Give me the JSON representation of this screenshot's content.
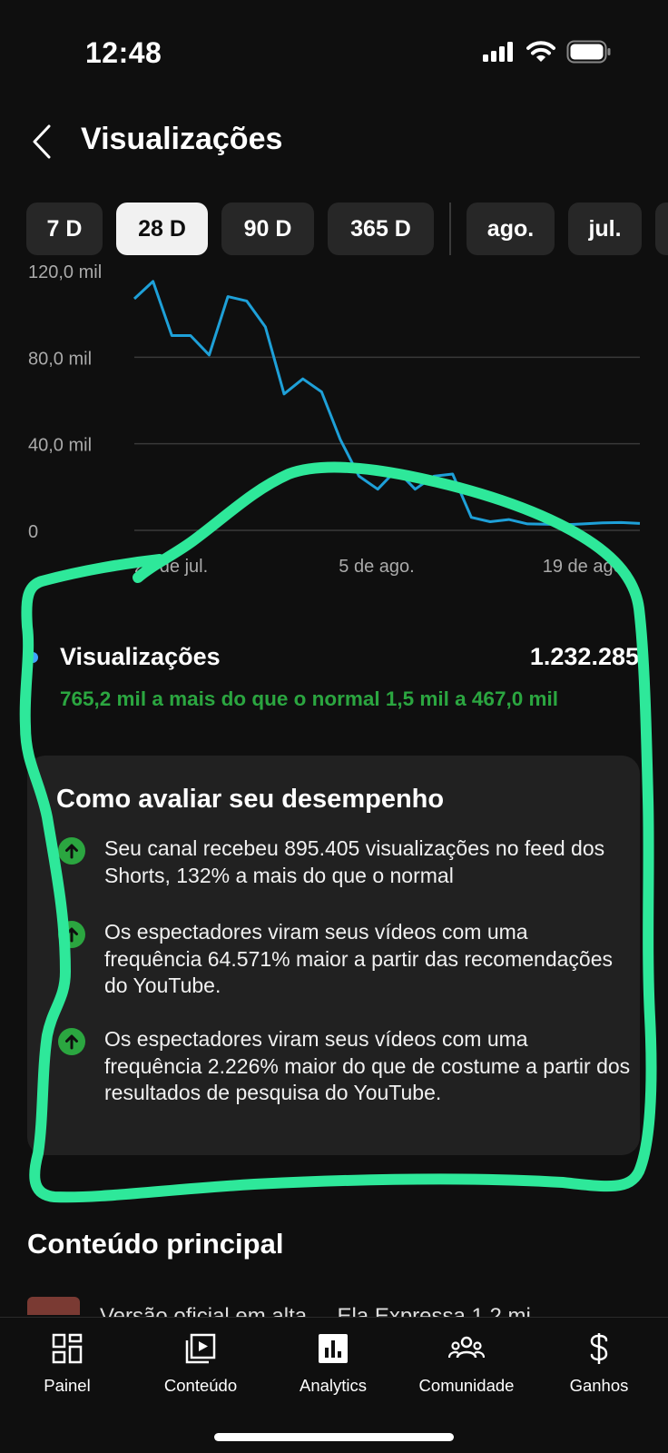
{
  "status_bar": {
    "time": "12:48"
  },
  "header": {
    "title": "Visualizações"
  },
  "periods": [
    {
      "label": "7 D",
      "selected": false
    },
    {
      "label": "28 D",
      "selected": true
    },
    {
      "label": "90 D",
      "selected": false
    },
    {
      "label": "365 D",
      "selected": false
    },
    {
      "label": "ago.",
      "selected": false
    },
    {
      "label": "jul.",
      "selected": false
    }
  ],
  "chart_data": {
    "type": "line",
    "y_ticks": [
      "120,0 mil",
      "80,0 mil",
      "40,0 mil",
      "0"
    ],
    "ylim": [
      0,
      120000
    ],
    "x_tick_labels": [
      "22 de jul.",
      "5 de ago.",
      "19 de ago."
    ],
    "grid": true,
    "series": [
      {
        "name": "Visualizações",
        "color": "#1ea0d8",
        "values": [
          107000,
          115000,
          90000,
          90000,
          81000,
          108000,
          106000,
          94000,
          63000,
          70000,
          64000,
          42000,
          25000,
          19000,
          28000,
          19000,
          25000,
          26000,
          6000,
          4000,
          5000,
          3000,
          2800,
          2600,
          3000,
          3500,
          3600,
          3200
        ]
      }
    ]
  },
  "summary": {
    "label": "Visualizações",
    "value": "1.232.285",
    "comparison": "765,2 mil a mais do que o normal 1,5 mil a 467,0 mil"
  },
  "insights_card": {
    "title": "Como avaliar seu desempenho",
    "items": [
      {
        "text": "Seu canal recebeu 895.405 visualizações no feed dos Shorts, 132% a mais do que o normal"
      },
      {
        "text": "Os espectadores viram seus vídeos com uma frequência 64.571% maior a partir das recomendações do YouTube."
      },
      {
        "text": "Os espectadores viram seus vídeos com uma frequência 2.226% maior do que de costume a partir dos resultados de pesquisa do YouTube."
      }
    ]
  },
  "top_content": {
    "title": "Conteúdo principal",
    "first_item_partial": "Versão oficial em alta ... Ela Expressa 1,2 mi"
  },
  "tabbar": {
    "items": [
      {
        "label": "Painel",
        "icon": "dashboard-icon"
      },
      {
        "label": "Conteúdo",
        "icon": "video-library-icon"
      },
      {
        "label": "Analytics",
        "icon": "analytics-icon"
      },
      {
        "label": "Comunidade",
        "icon": "community-icon"
      },
      {
        "label": "Ganhos",
        "icon": "dollar-icon"
      }
    ]
  },
  "annotation": {
    "color": "#2ee89a"
  }
}
